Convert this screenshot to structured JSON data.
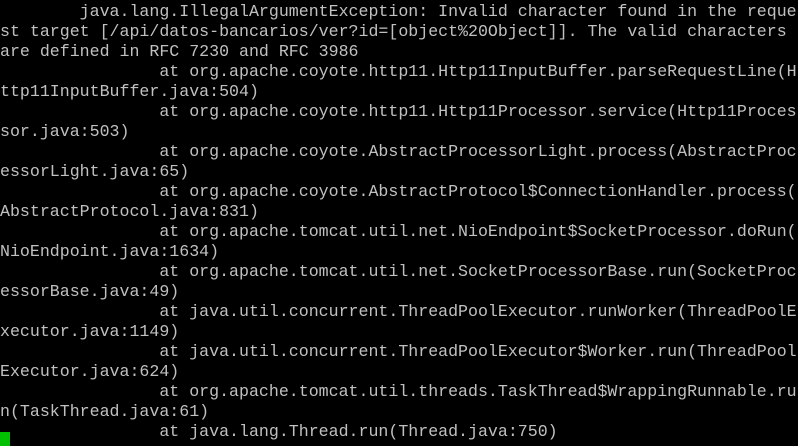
{
  "terminal": {
    "lines": [
      "        java.lang.IllegalArgumentException: Invalid character found in the reque",
      "st target [/api/datos-bancarios/ver?id=[object%20Object]]. The valid characters",
      "are defined in RFC 7230 and RFC 3986",
      "                at org.apache.coyote.http11.Http11InputBuffer.parseRequestLine(H",
      "ttp11InputBuffer.java:504)",
      "                at org.apache.coyote.http11.Http11Processor.service(Http11Proces",
      "sor.java:503)",
      "                at org.apache.coyote.AbstractProcessorLight.process(AbstractProc",
      "essorLight.java:65)",
      "                at org.apache.coyote.AbstractProtocol$ConnectionHandler.process(",
      "AbstractProtocol.java:831)",
      "                at org.apache.tomcat.util.net.NioEndpoint$SocketProcessor.doRun(",
      "NioEndpoint.java:1634)",
      "                at org.apache.tomcat.util.net.SocketProcessorBase.run(SocketProc",
      "essorBase.java:49)",
      "                at java.util.concurrent.ThreadPoolExecutor.runWorker(ThreadPoolE",
      "xecutor.java:1149)",
      "                at java.util.concurrent.ThreadPoolExecutor$Worker.run(ThreadPool",
      "Executor.java:624)",
      "                at org.apache.tomcat.util.threads.TaskThread$WrappingRunnable.ru",
      "n(TaskThread.java:61)",
      "                at java.lang.Thread.run(Thread.java:750)"
    ],
    "colors": {
      "background": "#000000",
      "text": "#c0c0c0",
      "cursor": "#00c000"
    }
  }
}
